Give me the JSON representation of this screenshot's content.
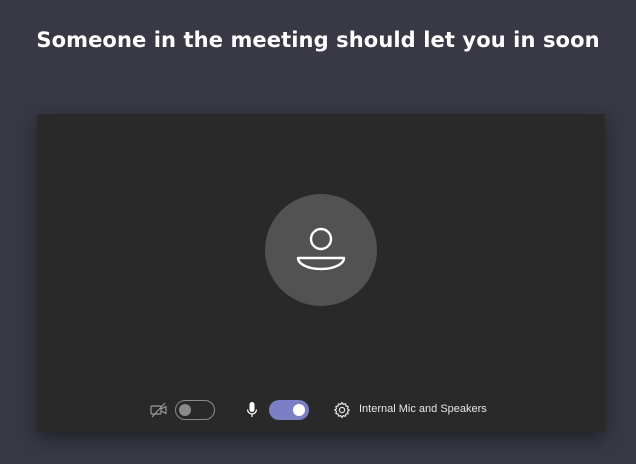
{
  "header": {
    "title": "Someone in the meeting should let you in soon"
  },
  "preview": {
    "avatar_icon": "person-icon"
  },
  "controls": {
    "camera": {
      "icon": "camera-off-icon",
      "enabled": false
    },
    "microphone": {
      "icon": "microphone-icon",
      "enabled": true
    },
    "device_settings": {
      "icon": "gear-icon",
      "label": "Internal Mic and Speakers"
    }
  },
  "colors": {
    "background": "#393946",
    "preview": "#292929",
    "avatar": "#525252",
    "accent": "#7b7fc4"
  }
}
